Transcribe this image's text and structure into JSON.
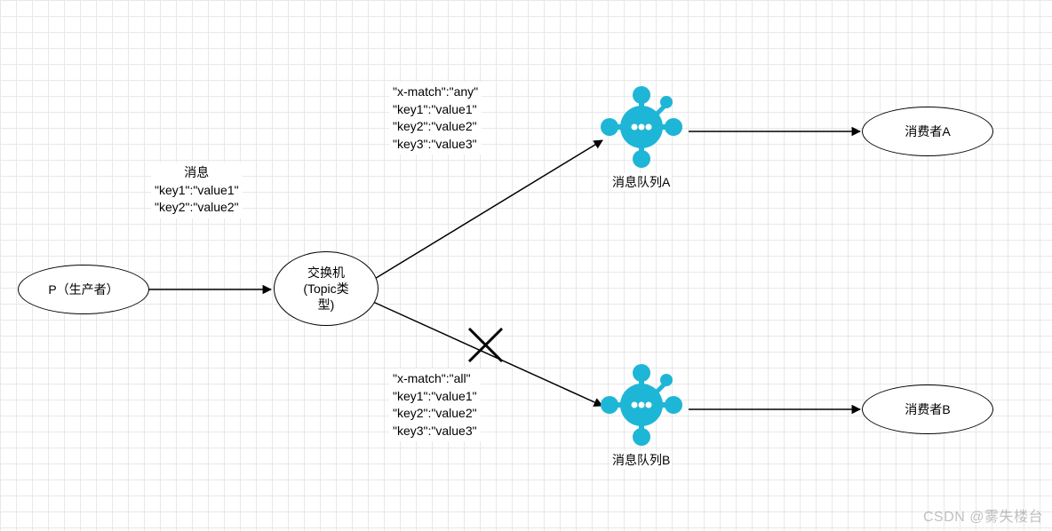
{
  "nodes": {
    "producer": "P（生产者）",
    "exchange_line1": "交换机",
    "exchange_line2": "(Topic类",
    "exchange_line3": "型)",
    "consumerA": "消费者A",
    "consumerB": "消费者B",
    "queueA_label": "消息队列A",
    "queueB_label": "消息队列B"
  },
  "msg_block": {
    "title": "消息",
    "l1": "\"key1\":\"value1\"",
    "l2": "\"key2\":\"value2\""
  },
  "bindingA": {
    "l1": "\"x-match\":\"any\"",
    "l2": "\"key1\":\"value1\"",
    "l3": "\"key2\":\"value2\"",
    "l4": "\"key3\":\"value3\""
  },
  "bindingB": {
    "l1": "\"x-match\":\"all\"",
    "l2": "\"key1\":\"value1\"",
    "l3": "\"key2\":\"value2\"",
    "l4": "\"key3\":\"value3\""
  },
  "watermark": "CSDN @雾失楼台"
}
